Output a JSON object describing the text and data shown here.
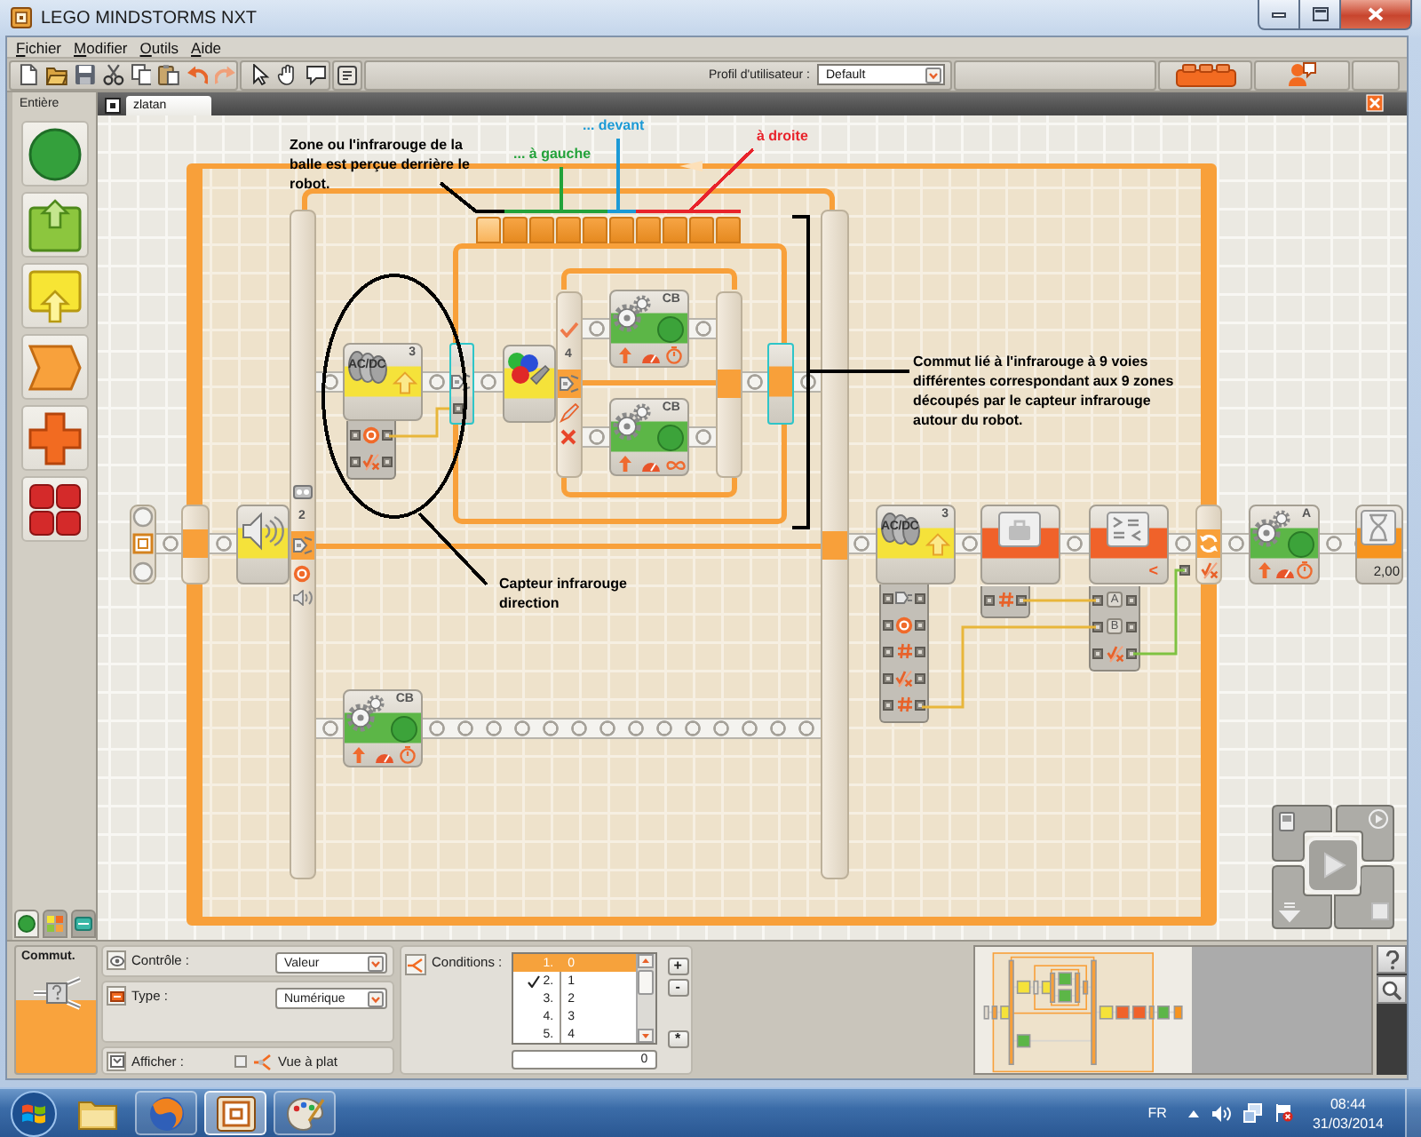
{
  "window": {
    "title": "LEGO MINDSTORMS NXT"
  },
  "menu": [
    {
      "label": "Fichier"
    },
    {
      "label": "Modifier"
    },
    {
      "label": "Outils"
    },
    {
      "label": "Aide"
    }
  ],
  "toolbar": {
    "profile_label": "Profil d'utilisateur :",
    "profile": "Default"
  },
  "palette": {
    "title": "Entière",
    "tabs": [
      {
        "selected": true
      },
      {
        "selected": false
      },
      {
        "selected": false
      }
    ]
  },
  "program": {
    "tab": "zlatan",
    "blocks": [
      {
        "kind": "start"
      },
      {
        "kind": "loop_start"
      },
      {
        "kind": "sound_sensor"
      },
      {
        "kind": "switch_beam",
        "port": "2"
      },
      {
        "kind": "ir_sensor",
        "icon_text": "AC/DC",
        "port": "3",
        "hub_expanded": false
      },
      {
        "kind": "switch_in"
      },
      {
        "kind": "color_sensor"
      },
      {
        "kind": "switch_beam",
        "port": "4"
      },
      {
        "kind": "motor",
        "port": "CB",
        "unlimited": false
      },
      {
        "kind": "motor",
        "port": "CB",
        "unlimited": true
      },
      {
        "kind": "switch_end"
      },
      {
        "kind": "switch_out"
      },
      {
        "kind": "switch_end"
      },
      {
        "kind": "motor",
        "port": "CB",
        "unlimited": false
      },
      {
        "kind": "ir_sensor",
        "icon_text": "AC/DC",
        "port": "3",
        "hub_expanded": true
      },
      {
        "kind": "variable"
      },
      {
        "kind": "compare",
        "operator": "<",
        "inputs": [
          "A",
          "B"
        ]
      },
      {
        "kind": "loop_end"
      },
      {
        "kind": "motor",
        "port": "A",
        "unlimited": false
      },
      {
        "kind": "wait",
        "value": "2,00"
      }
    ],
    "switch_tabs": [
      {
        "selected": true
      },
      {
        "selected": false
      },
      {
        "selected": false
      },
      {
        "selected": false
      },
      {
        "selected": false
      },
      {
        "selected": false
      },
      {
        "selected": false
      },
      {
        "selected": false
      },
      {
        "selected": false
      },
      {
        "selected": false
      }
    ],
    "annotations": [
      {
        "text": "Zone ou l'infrarouge de la balle est perçue derrière le robot.",
        "color": "#000000"
      },
      {
        "text": "... à gauche",
        "color": "#23a23a"
      },
      {
        "text": "... devant",
        "color": "#1c9ad6"
      },
      {
        "text": "à droite",
        "color": "#e8232b"
      },
      {
        "text": "Commut lié à l'infrarouge à 9 voies différentes correspondant aux 9 zones découpés par le capteur infrarouge autour du robot.",
        "color": "#000000"
      },
      {
        "text": "Capteur infrarouge direction",
        "color": "#000000"
      }
    ]
  },
  "config": {
    "title": "Commut.",
    "control": {
      "label": "Contrôle :",
      "value": "Valeur"
    },
    "type": {
      "label": "Type :",
      "value": "Numérique"
    },
    "display": {
      "label": "Afficher :",
      "flat_view": false,
      "option": "Vue à plat"
    },
    "conditions": {
      "label": "Conditions :",
      "rows": [
        {
          "number": "1.",
          "value": "0",
          "selected": true,
          "default": false
        },
        {
          "number": "2.",
          "value": "1",
          "selected": false,
          "default": true
        },
        {
          "number": "3.",
          "value": "2",
          "selected": false,
          "default": false
        },
        {
          "number": "4.",
          "value": "3",
          "selected": false,
          "default": false
        },
        {
          "number": "5.",
          "value": "4",
          "selected": false,
          "default": false
        }
      ],
      "value": "0",
      "buttons": [
        "+",
        "-",
        "*"
      ]
    }
  },
  "taskbar": {
    "apps": [
      {
        "running": false,
        "selected": false
      },
      {
        "running": true,
        "selected": false
      },
      {
        "running": true,
        "selected": true
      },
      {
        "running": true,
        "selected": false
      }
    ],
    "language": "FR",
    "time": "08:44",
    "date": "31/03/2014"
  }
}
